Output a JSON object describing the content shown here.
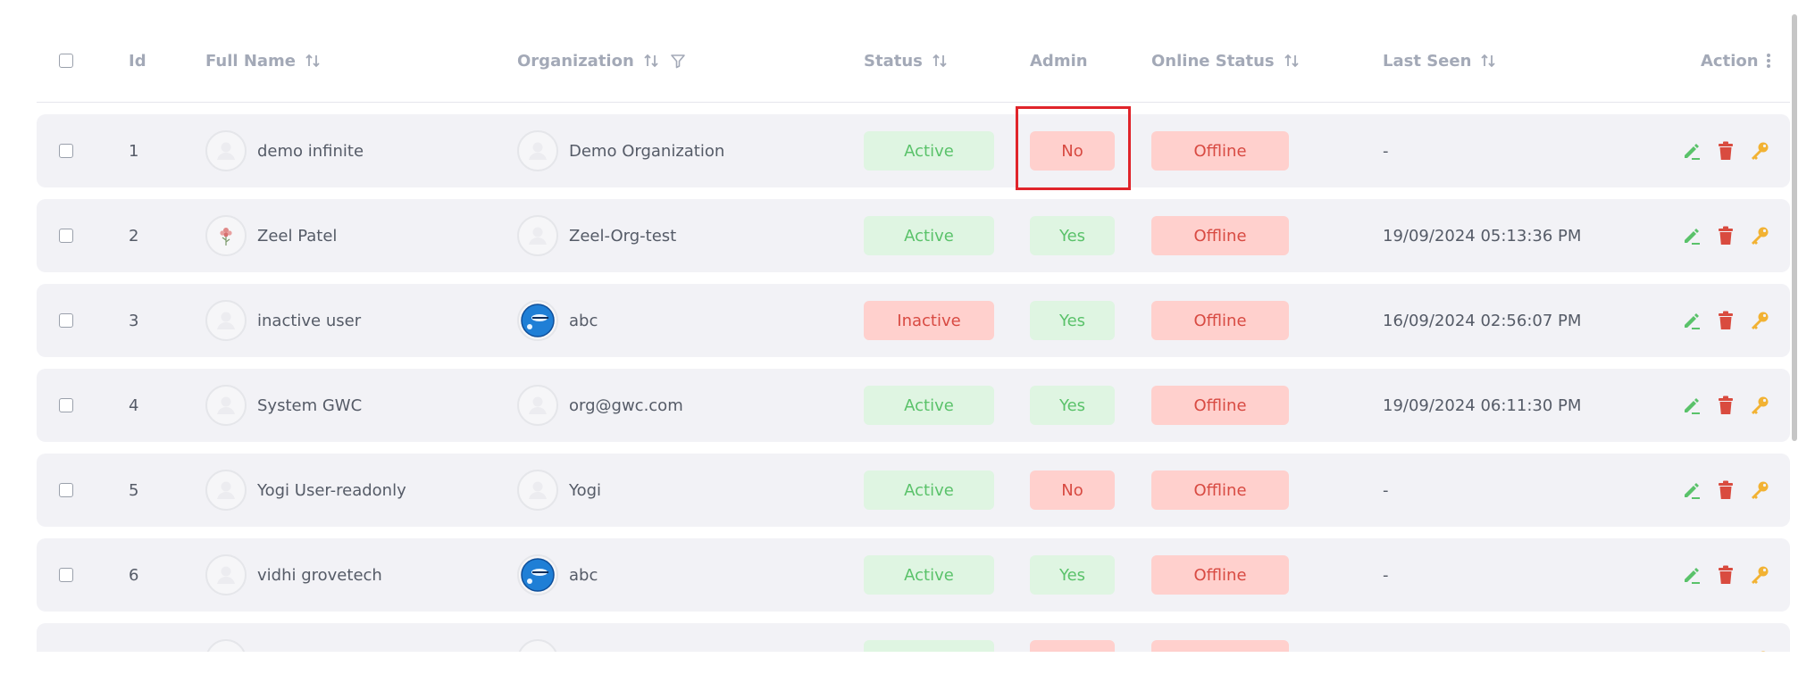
{
  "header": {
    "id": "Id",
    "full_name": "Full Name",
    "organization": "Organization",
    "status": "Status",
    "admin": "Admin",
    "online_status": "Online Status",
    "last_seen": "Last Seen",
    "action": "Action"
  },
  "rows": [
    {
      "id": "1",
      "name": "demo infinite",
      "org": "Demo Organization",
      "status": "Active",
      "admin": "No",
      "online": "Offline",
      "last_seen": "-"
    },
    {
      "id": "2",
      "name": "Zeel Patel",
      "org": "Zeel-Org-test",
      "status": "Active",
      "admin": "Yes",
      "online": "Offline",
      "last_seen": "19/09/2024 05:13:36 PM"
    },
    {
      "id": "3",
      "name": "inactive user",
      "org": "abc",
      "status": "Inactive",
      "admin": "Yes",
      "online": "Offline",
      "last_seen": "16/09/2024 02:56:07 PM"
    },
    {
      "id": "4",
      "name": "System GWC",
      "org": "org@gwc.com",
      "status": "Active",
      "admin": "Yes",
      "online": "Offline",
      "last_seen": "19/09/2024 06:11:30 PM"
    },
    {
      "id": "5",
      "name": "Yogi User-readonly",
      "org": "Yogi",
      "status": "Active",
      "admin": "No",
      "online": "Offline",
      "last_seen": "-"
    },
    {
      "id": "6",
      "name": "vidhi grovetech",
      "org": "abc",
      "status": "Active",
      "admin": "Yes",
      "online": "Offline",
      "last_seen": "-"
    }
  ],
  "icons": {
    "edit": "pencil-icon",
    "delete": "trash-icon",
    "key": "key-icon"
  },
  "colors": {
    "active_bg": "#dff5e2",
    "active_text": "#5ac26a",
    "danger_bg": "#ffd0cd",
    "danger_text": "#d84a42",
    "edit": "#5ac26a",
    "delete": "#d94b3f",
    "key": "#f2b233",
    "highlight": "#e0242a"
  }
}
